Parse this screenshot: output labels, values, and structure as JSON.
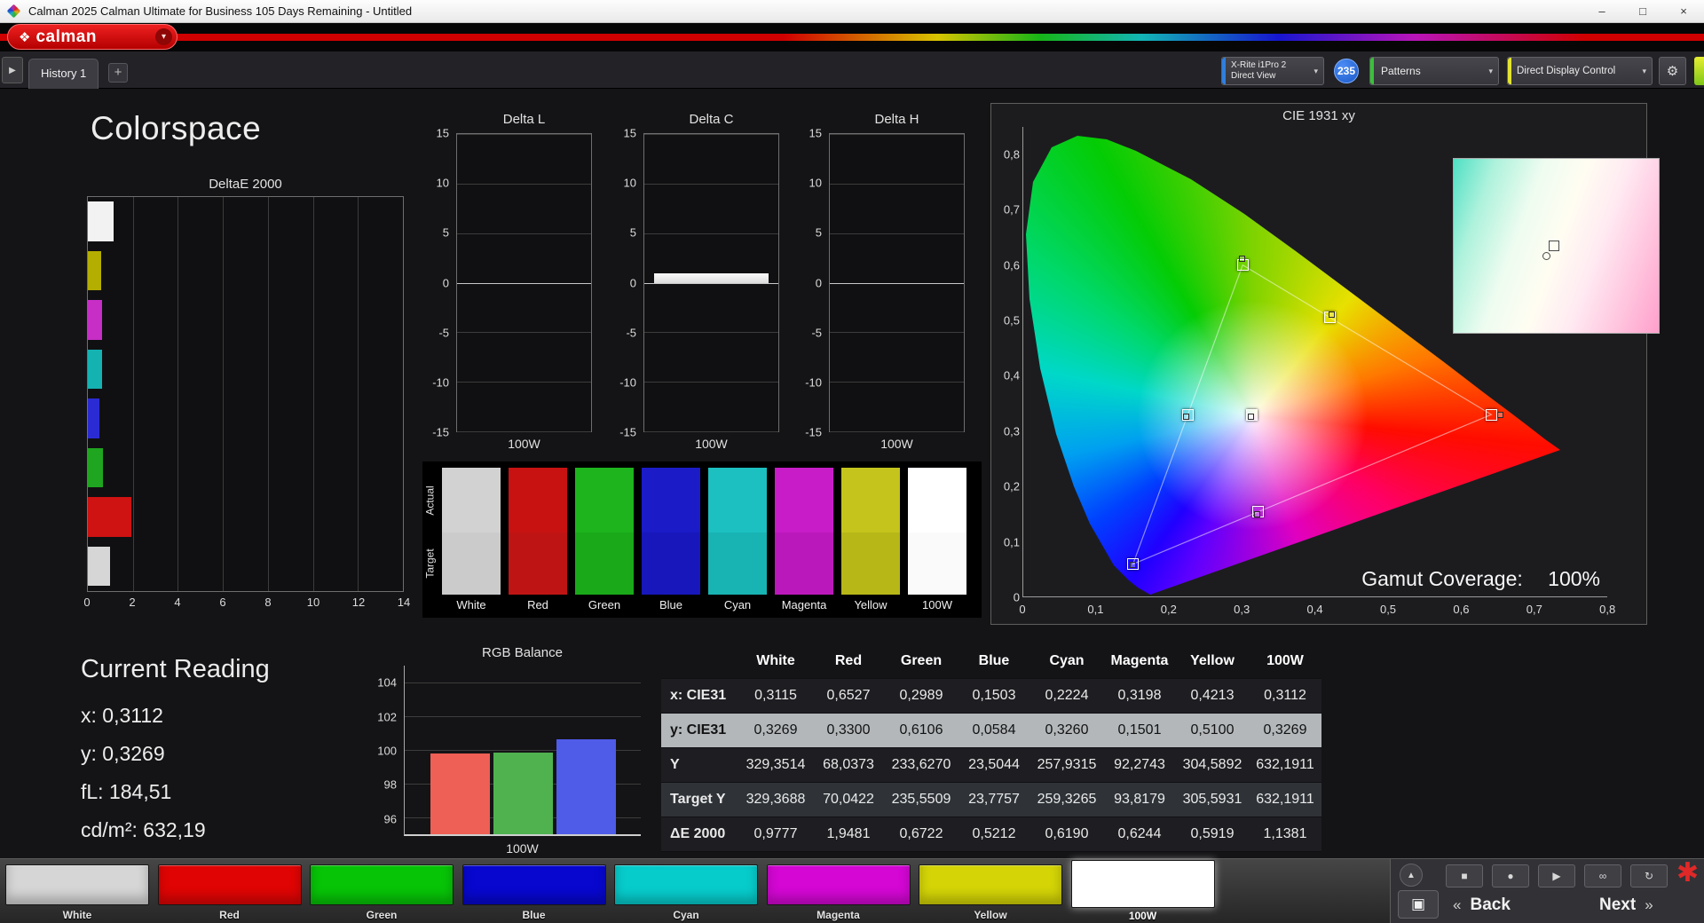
{
  "titlebar": {
    "title": "Calman 2025 Calman Ultimate for Business 105 Days Remaining  - Untitled"
  },
  "icons": {
    "minimize": "–",
    "maximize": "□",
    "close": "×",
    "dropdown": "▾",
    "gear": "⚙",
    "play": "▶",
    "diamond": "❖",
    "add": "+",
    "up": "▲",
    "monitor": "▣",
    "back_chevrons": "«",
    "next_chevrons": "»",
    "star": "✱"
  },
  "brand": {
    "logo_text": "calman"
  },
  "tabs": {
    "history": "History 1"
  },
  "device_bar": {
    "meter_line1": "X-Rite i1Pro 2",
    "meter_line2": "Direct View",
    "badge": "235",
    "patterns": "Patterns",
    "display_control": "Direct Display Control"
  },
  "page": {
    "title": "Colorspace"
  },
  "current_reading": {
    "title": "Current Reading",
    "lines": [
      "x: 0,3112",
      "y: 0,3269",
      "fL: 184,51",
      "cd/m²: 632,19"
    ]
  },
  "gamut": {
    "coverage_label": "Gamut Coverage:",
    "coverage_value": "100%"
  },
  "swatch_panel": {
    "row_labels": [
      "Actual",
      "Target"
    ],
    "columns": [
      {
        "label": "White",
        "actual": "#d2d2d2",
        "target": "#cbcbcb"
      },
      {
        "label": "Red",
        "actual": "#c81212",
        "target": "#bf1414"
      },
      {
        "label": "Green",
        "actual": "#1db41d",
        "target": "#19a919"
      },
      {
        "label": "Blue",
        "actual": "#1b1bc8",
        "target": "#1717bb"
      },
      {
        "label": "Cyan",
        "actual": "#1cc0c0",
        "target": "#18b3b3"
      },
      {
        "label": "Magenta",
        "actual": "#c81cc8",
        "target": "#bb18bb"
      },
      {
        "label": "Yellow",
        "actual": "#c4c41c",
        "target": "#b7b718"
      },
      {
        "label": "100W",
        "actual": "#ffffff",
        "target": "#fafafa"
      }
    ]
  },
  "table": {
    "headers": [
      "",
      "White",
      "Red",
      "Green",
      "Blue",
      "Cyan",
      "Magenta",
      "Yellow",
      "100W"
    ],
    "rows": [
      {
        "label": "x: CIE31",
        "style": "",
        "values": [
          "0,3115",
          "0,6527",
          "0,2989",
          "0,1503",
          "0,2224",
          "0,3198",
          "0,4213",
          "0,3112"
        ]
      },
      {
        "label": "y: CIE31",
        "style": "hl",
        "values": [
          "0,3269",
          "0,3300",
          "0,6106",
          "0,0584",
          "0,3260",
          "0,1501",
          "0,5100",
          "0,3269"
        ]
      },
      {
        "label": "Y",
        "style": "",
        "values": [
          "329,3514",
          "68,0373",
          "233,6270",
          "23,5044",
          "257,9315",
          "92,2743",
          "304,5892",
          "632,1911"
        ]
      },
      {
        "label": "Target Y",
        "style": "shade",
        "values": [
          "329,3688",
          "70,0422",
          "235,5509",
          "23,7757",
          "259,3265",
          "93,8179",
          "305,5931",
          "632,1911"
        ]
      },
      {
        "label": "ΔE 2000",
        "style": "",
        "values": [
          "0,9777",
          "1,9481",
          "0,6722",
          "0,5212",
          "0,6190",
          "0,6244",
          "0,5919",
          "1,1381"
        ]
      }
    ]
  },
  "bottom_bar": {
    "swatches": [
      {
        "label": "White",
        "color": "#d6d6d6",
        "selected": false
      },
      {
        "label": "Red",
        "color": "#e00404",
        "selected": false
      },
      {
        "label": "Green",
        "color": "#07c407",
        "selected": false
      },
      {
        "label": "Blue",
        "color": "#0707d0",
        "selected": false
      },
      {
        "label": "Cyan",
        "color": "#07cccc",
        "selected": false
      },
      {
        "label": "Magenta",
        "color": "#d407d4",
        "selected": false
      },
      {
        "label": "Yellow",
        "color": "#d4d407",
        "selected": false
      },
      {
        "label": "100W",
        "color": "#ffffff",
        "selected": true
      }
    ],
    "tools": [
      {
        "name": "stop-icon",
        "glyph": "■"
      },
      {
        "name": "record-icon",
        "glyph": "●"
      },
      {
        "name": "play-icon",
        "glyph": "▶"
      },
      {
        "name": "link-icon",
        "glyph": "∞"
      },
      {
        "name": "refresh-icon",
        "glyph": "↻"
      }
    ],
    "back_label": "Back",
    "next_label": "Next"
  },
  "chart_data": [
    {
      "type": "bar",
      "orientation": "horizontal",
      "title": "DeltaE 2000",
      "categories": [
        "100W",
        "Yellow",
        "Magenta",
        "Cyan",
        "Blue",
        "Green",
        "Red",
        "White"
      ],
      "values": [
        1.1381,
        0.5919,
        0.6244,
        0.619,
        0.5212,
        0.6722,
        1.9481,
        0.9777
      ],
      "colors": [
        "#f2f2f2",
        "#b4ae00",
        "#c62ec6",
        "#15b2b2",
        "#2b2bd4",
        "#1fa51f",
        "#cf1212",
        "#d6d6d6"
      ],
      "xlim": [
        0,
        14
      ],
      "xticks": [
        0,
        2,
        4,
        6,
        8,
        10,
        12,
        14
      ]
    },
    {
      "type": "bar",
      "title": "Delta L",
      "categories": [
        "100W"
      ],
      "values": [
        0
      ],
      "ylim": [
        -15,
        15
      ],
      "yticks": [
        15,
        10,
        5,
        0,
        -5,
        -10,
        -15
      ],
      "xlabel": "100W"
    },
    {
      "type": "bar",
      "title": "Delta C",
      "categories": [
        "100W"
      ],
      "values": [
        0.9
      ],
      "ylim": [
        -15,
        15
      ],
      "yticks": [
        15,
        10,
        5,
        0,
        -5,
        -10,
        -15
      ],
      "xlabel": "100W"
    },
    {
      "type": "bar",
      "title": "Delta H",
      "categories": [
        "100W"
      ],
      "values": [
        0
      ],
      "ylim": [
        -15,
        15
      ],
      "yticks": [
        15,
        10,
        5,
        0,
        -5,
        -10,
        -15
      ],
      "xlabel": "100W"
    },
    {
      "type": "bar",
      "title": "RGB Balance",
      "categories": [
        "Red",
        "Green",
        "Blue"
      ],
      "values": [
        99.8,
        99.85,
        100.65
      ],
      "colors": [
        "#ee5f55",
        "#4fb24f",
        "#4f5ce8"
      ],
      "ylim": [
        95,
        105
      ],
      "yticks": [
        104,
        102,
        100,
        98,
        96
      ],
      "xlabel": "100W"
    },
    {
      "type": "chromaticity",
      "title": "CIE 1931 xy",
      "x_ticks": [
        "0",
        "0,1",
        "0,2",
        "0,3",
        "0,4",
        "0,5",
        "0,6",
        "0,7",
        "0,8"
      ],
      "y_ticks": [
        "0",
        "0,1",
        "0,2",
        "0,3",
        "0,4",
        "0,5",
        "0,6",
        "0,7",
        "0,8"
      ],
      "targets": [
        {
          "name": "White",
          "x": 0.3127,
          "y": 0.329
        },
        {
          "name": "Red",
          "x": 0.64,
          "y": 0.33
        },
        {
          "name": "Green",
          "x": 0.3,
          "y": 0.6
        },
        {
          "name": "Blue",
          "x": 0.15,
          "y": 0.06
        },
        {
          "name": "Cyan",
          "x": 0.2246,
          "y": 0.3287
        },
        {
          "name": "Magenta",
          "x": 0.3209,
          "y": 0.1542
        },
        {
          "name": "Yellow",
          "x": 0.4193,
          "y": 0.5053
        }
      ],
      "measured": [
        {
          "name": "White",
          "x": 0.3115,
          "y": 0.3269
        },
        {
          "name": "Red",
          "x": 0.6527,
          "y": 0.33
        },
        {
          "name": "Green",
          "x": 0.2989,
          "y": 0.6106
        },
        {
          "name": "Blue",
          "x": 0.1503,
          "y": 0.0584
        },
        {
          "name": "Cyan",
          "x": 0.2224,
          "y": 0.326
        },
        {
          "name": "Magenta",
          "x": 0.3198,
          "y": 0.1501
        },
        {
          "name": "Yellow",
          "x": 0.4213,
          "y": 0.51
        },
        {
          "name": "100W",
          "x": 0.3112,
          "y": 0.3269
        }
      ],
      "coverage": "100%"
    }
  ]
}
